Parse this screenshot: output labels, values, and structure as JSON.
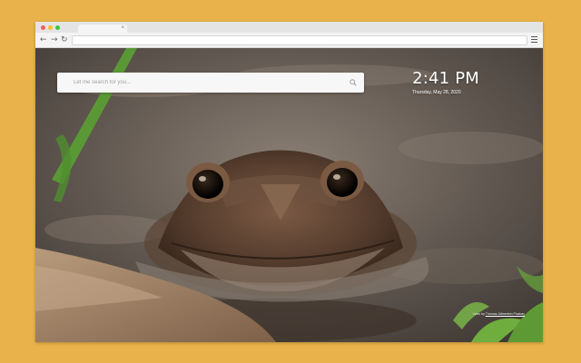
{
  "browser": {
    "tab": {
      "close_symbol": "×"
    },
    "toolbar": {
      "back_icon": "arrow-left-icon",
      "forward_icon": "arrow-right-icon",
      "reload_icon": "reload-icon",
      "menu_icon": "hamburger-menu-icon"
    },
    "window_controls": {
      "close_color": "#f25f58",
      "minimize_color": "#fbbe2f",
      "maximize_color": "#3dc442"
    }
  },
  "newtab": {
    "search": {
      "placeholder": "Let me search for you...",
      "icon": "search-icon"
    },
    "clock": {
      "time": "2:41 PM",
      "date": "Thursday, May 28, 2020"
    },
    "credit": {
      "prefix": "Video by ",
      "author": "Thomas Jöttnerlein Pixabay"
    },
    "background": {
      "subject": "frog-in-water-photo",
      "accent_color": "#e9b24a"
    }
  },
  "glyphs": {
    "back": "←",
    "forward": "→",
    "reload": "↻"
  }
}
